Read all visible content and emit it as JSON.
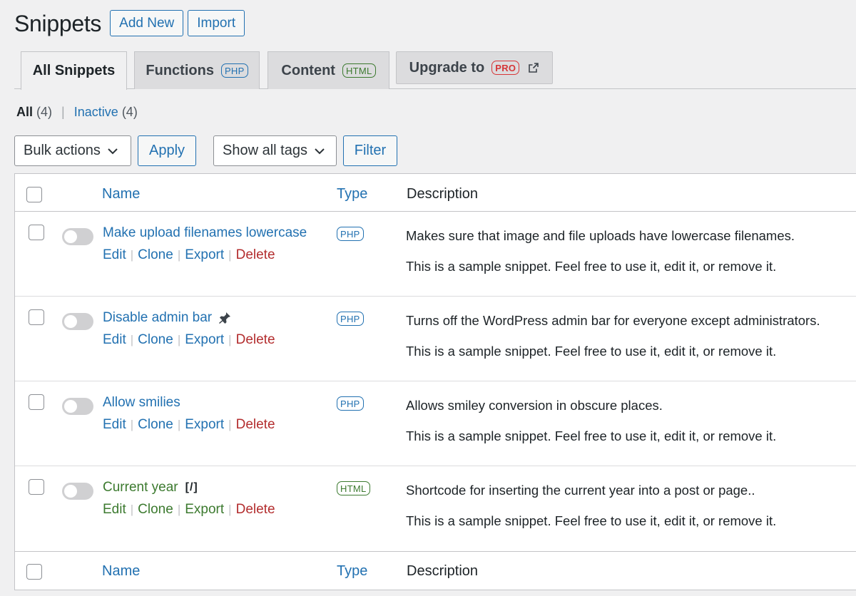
{
  "header": {
    "title": "Snippets",
    "add_new": "Add New",
    "import": "Import"
  },
  "tabs": [
    {
      "label": "All Snippets",
      "badge": ""
    },
    {
      "label": "Functions",
      "badge": "PHP"
    },
    {
      "label": "Content",
      "badge": "HTML"
    },
    {
      "label": "Upgrade to",
      "badge": "PRO",
      "icon": "external-link-icon"
    }
  ],
  "views": {
    "all_label": "All",
    "all_count": "(4)",
    "sep": "|",
    "inactive_label": "Inactive",
    "inactive_count": "(4)"
  },
  "actions": {
    "bulk": "Bulk actions",
    "apply": "Apply",
    "tags": "Show all tags",
    "filter": "Filter"
  },
  "table": {
    "columns": {
      "name": "Name",
      "type": "Type",
      "description": "Description"
    },
    "row_actions": {
      "edit": "Edit",
      "clone": "Clone",
      "export": "Export",
      "delete": "Delete",
      "sep": "|"
    },
    "rows": [
      {
        "name": "Make upload filenames lowercase",
        "type": "PHP",
        "active": false,
        "description": "Makes sure that image and file uploads have lowercase filenames.",
        "note": "This is a sample snippet. Feel free to use it, edit it, or remove it."
      },
      {
        "name": "Disable admin bar",
        "type": "PHP",
        "active": false,
        "icon": "pin-icon",
        "description": "Turns off the WordPress admin bar for everyone except administrators.",
        "note": "This is a sample snippet. Feel free to use it, edit it, or remove it."
      },
      {
        "name": "Allow smilies",
        "type": "PHP",
        "active": false,
        "description": "Allows smiley conversion in obscure places.",
        "note": "This is a sample snippet. Feel free to use it, edit it, or remove it."
      },
      {
        "name": "Current year",
        "type": "HTML",
        "active": false,
        "shortcode_symbol": "[/]",
        "description": "Shortcode for inserting the current year into a post or page..",
        "note": "This is a sample snippet. Feel free to use it, edit it, or remove it."
      }
    ]
  },
  "colors": {
    "link": "#2271b1",
    "html_green": "#3c7a2f",
    "delete_red": "#b32d2e",
    "pro_red": "#d63638",
    "background": "#f0f0f1"
  }
}
